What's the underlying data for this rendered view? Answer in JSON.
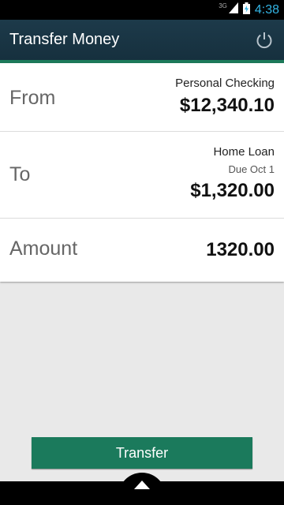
{
  "status_bar": {
    "network": "3G",
    "time": "4:38"
  },
  "header": {
    "title": "Transfer Money"
  },
  "transfer": {
    "from": {
      "label": "From",
      "account": "Personal Checking",
      "balance": "$12,340.10"
    },
    "to": {
      "label": "To",
      "account": "Home Loan",
      "due": "Due Oct 1",
      "balance": "$1,320.00"
    },
    "amount": {
      "label": "Amount",
      "value": "1320.00"
    }
  },
  "actions": {
    "transfer_label": "Transfer"
  },
  "colors": {
    "accent": "#1b7a5c",
    "header_bg": "#1d3a4a",
    "time": "#33b5e5"
  },
  "icons": {
    "header_right": "power-icon",
    "bottom": "chevron-up-icon"
  }
}
